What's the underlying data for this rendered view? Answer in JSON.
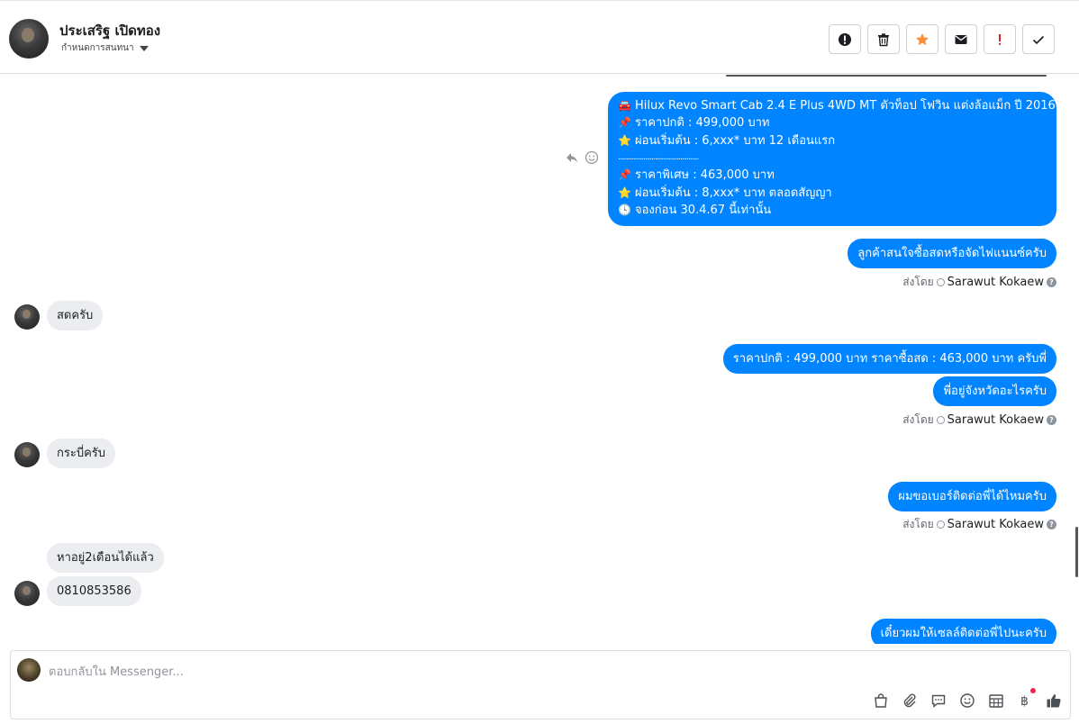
{
  "header": {
    "contact_name": "ประเสริฐ เปิดทอง",
    "assign_label": "กำหนดการสนทนา",
    "actions": [
      {
        "name": "spam-button",
        "icon": "alert-circle-icon"
      },
      {
        "name": "delete-button",
        "icon": "trash-icon"
      },
      {
        "name": "star-button",
        "icon": "star-icon",
        "color": "#f7923b"
      },
      {
        "name": "mark-unread-button",
        "icon": "envelope-icon"
      },
      {
        "name": "important-button",
        "icon": "exclamation-icon",
        "color": "#e02020"
      },
      {
        "name": "mark-done-button",
        "icon": "check-icon"
      }
    ]
  },
  "messages": {
    "listing": {
      "lines": [
        {
          "emoji": "🚘",
          "text": "Hilux Revo Smart Cab 2.4 E Plus 4WD MT ตัวท็อป โฟวิน แต่งล้อแม็ก ปี 2016"
        },
        {
          "emoji": "📌",
          "text": "ราคาปกติ : 499,000 บาท"
        },
        {
          "emoji": "⭐",
          "text": "ผ่อนเริ่มต้น : 6,xxx* บาท 12 เดือนแรก"
        },
        {
          "emoji": "",
          "text": "................................................"
        },
        {
          "emoji": "📌",
          "text": "ราคาพิเศษ : 463,000 บาท"
        },
        {
          "emoji": "⭐",
          "text": "ผ่อนเริ่มต้น : 8,xxx* บาท ตลอดสัญญา"
        },
        {
          "emoji": "🕓",
          "text": "จองก่อน 30.4.67 นี้เท่านั้น"
        }
      ]
    },
    "m1": "ลูกค้าสนใจซื้อสดหรือจัดไฟแนนซ์ครับ",
    "m2": "สดครับ",
    "m3": "ราคาปกติ : 499,000 บาท ราคาซื้อสด : 463,000 บาท ครับพี่",
    "m4": "พี่อยู่จังหวัดอะไรครับ",
    "m5": "กระบี่ครับ",
    "m6": "ผมขอเบอร์ติดต่อพี่ได้ไหมครับ",
    "m7": "หาอยู่2เดือนได้แล้ว",
    "m8": "0810853586",
    "m9": "เดี๋ยวผมให้เซลล์ติดต่อพี่ไปนะครับ"
  },
  "sent_by": {
    "prefix": "ส่งโดย",
    "agent": "Sarawut Kokaew",
    "help": "?"
  },
  "composer": {
    "placeholder": "ตอบกลับใน Messenger..."
  },
  "tools": [
    "shop-icon",
    "attach-icon",
    "saved-reply-icon",
    "emoji-icon",
    "appointment-icon",
    "baht-icon",
    "like-icon"
  ],
  "colors": {
    "accent": "#0084ff",
    "incoming": "#ebedf0",
    "badge": "#f02849"
  }
}
